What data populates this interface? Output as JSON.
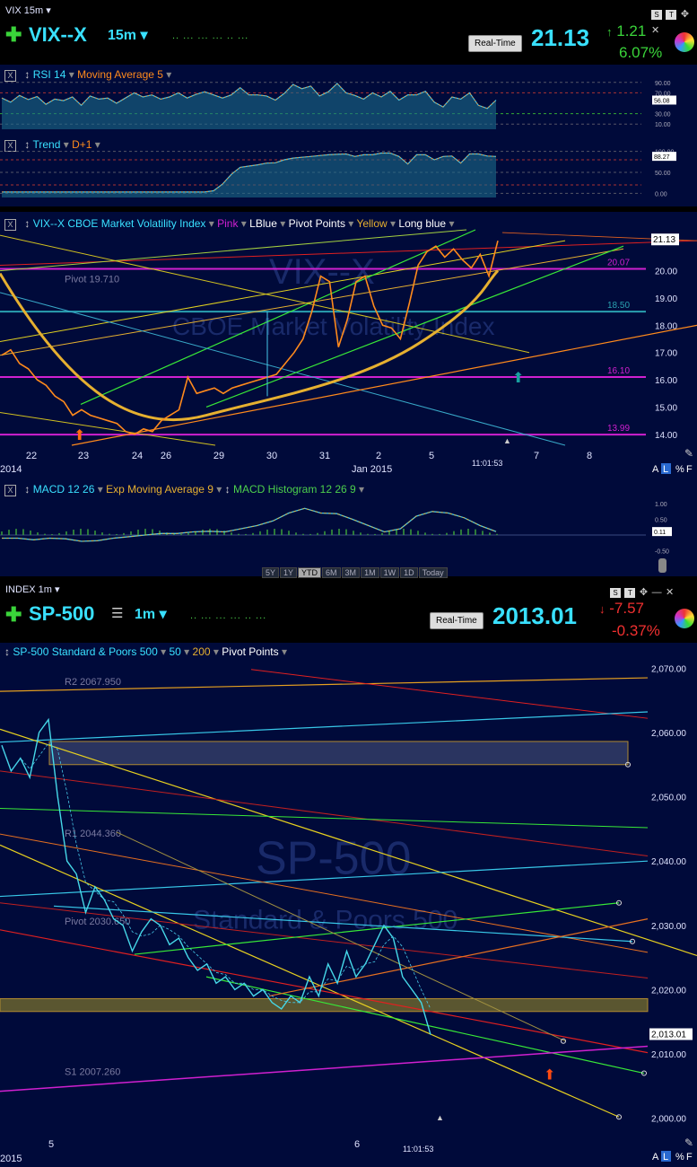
{
  "vix": {
    "window_label": "VIX 15m",
    "symbol": "VIX--X",
    "timeframe": "15m",
    "realtime_label": "Real-Time",
    "price": "21.13",
    "change": "1.21",
    "change_pct": "6.07%",
    "rsi_title": "RSI 14",
    "rsi_ma": "Moving Average 5",
    "trend_title": "Trend",
    "trend_sub": "D+1",
    "main_title": "VIX--X CBOE Market Volatility Index",
    "overlays": [
      "Pink",
      "LBlue",
      "Pivot Points",
      "Yellow",
      "Long blue"
    ],
    "pivot_label": "Pivot 19.710",
    "watermark1": "VIX--X",
    "watermark2": "CBOE Market Volatility Index",
    "macd_title": "MACD 12 26",
    "macd_ema": "Exp Moving Average 9",
    "macd_hist": "MACD Histogram 12 26 9",
    "time_label": "11:01:53",
    "date_left": "2014",
    "date_mid": "Jan 2015",
    "scale_buttons": [
      "A",
      "L",
      "%",
      "F"
    ],
    "range_buttons": [
      "5Y",
      "1Y",
      "YTD",
      "6M",
      "3M",
      "1M",
      "1W",
      "1D",
      "Today"
    ]
  },
  "spx": {
    "window_label": "INDEX 1m",
    "symbol": "SP-500",
    "timeframe": "1m",
    "realtime_label": "Real-Time",
    "price": "2013.01",
    "change": "-7.57",
    "change_pct": "-0.37%",
    "main_title": "SP-500 Standard & Poors 500",
    "overlays": [
      "50",
      "200",
      "Pivot Points"
    ],
    "r2_label": "R2 2067.950",
    "r1_label": "R1 2044.360",
    "pivot_label": "Pivot 2030.650",
    "s1_label": "S1 2007.260",
    "watermark1": "SP-500",
    "watermark2": "Standard & Poors 500",
    "time_label": "11:01:53",
    "date_left": "2015",
    "scale_buttons": [
      "A",
      "L",
      "%",
      "F"
    ]
  },
  "chart_data": [
    {
      "type": "line",
      "title": "VIX--X CBOE Market Volatility Index",
      "x_ticks": [
        "22",
        "23",
        "24",
        "26",
        "29",
        "30",
        "31",
        "2",
        "5",
        "7",
        "8"
      ],
      "y_ticks": [
        "14.00",
        "15.00",
        "16.00",
        "17.00",
        "18.00",
        "19.00",
        "20.00"
      ],
      "ylim": [
        13.6,
        21.5
      ],
      "last_price": "21.13",
      "price_labels": [
        "20.07",
        "18.50",
        "16.10",
        "13.99"
      ],
      "colors": {
        "price": "#ff8a1c",
        "ma": "#e6b030",
        "pink": "#d020d0",
        "lblue": "#38c8e8",
        "green": "#38e838",
        "red": "#e02020",
        "yellow": "#e0d020"
      },
      "series": [
        {
          "values": [
            16.9,
            17.1,
            16.6,
            16.4,
            16.0,
            15.8,
            15.4,
            15.2,
            14.7,
            14.9,
            14.7,
            14.6,
            14.5,
            14.4,
            14.1,
            14.0,
            14.2,
            14.1,
            14.5,
            14.7,
            14.9,
            16.1,
            15.5,
            15.6,
            15.7,
            15.5,
            15.7,
            15.8,
            15.9,
            16.0,
            16.1,
            16.2,
            16.6,
            17.0,
            17.5,
            18.5,
            19.8,
            19.6,
            17.2,
            18.2,
            19.6,
            19.8,
            18.7,
            18.0,
            17.9,
            17.5,
            18.8,
            20.2,
            20.7,
            20.9,
            20.5,
            20.8,
            20.4,
            20.1,
            20.6,
            19.8,
            21.1
          ]
        }
      ]
    },
    {
      "type": "line",
      "title": "RSI 14",
      "y_ticks": [
        "90.00",
        "70.00",
        "30.00",
        "10.00"
      ],
      "ylim": [
        0,
        100
      ],
      "last_value": "56.08",
      "series": [
        {
          "values": [
            60,
            52,
            65,
            57,
            63,
            48,
            58,
            55,
            62,
            46,
            64,
            58,
            60,
            50,
            60,
            70,
            62,
            66,
            58,
            62,
            70,
            60,
            67,
            72,
            66,
            60,
            66,
            80,
            66,
            66,
            64,
            56,
            69,
            86,
            78,
            83,
            64,
            72,
            88,
            70,
            65,
            58,
            70,
            62,
            73,
            56,
            66,
            66,
            73,
            52,
            43,
            62,
            58,
            70,
            46,
            40,
            56
          ]
        }
      ]
    },
    {
      "type": "line",
      "title": "Trend",
      "y_ticks": [
        "100.00",
        "50.00",
        "0.00"
      ],
      "ylim": [
        -10,
        110
      ],
      "last_value": "88.27",
      "series": [
        {
          "values": [
            3,
            3,
            3,
            3,
            3,
            3,
            3,
            3,
            3,
            3,
            3,
            3,
            3,
            3,
            3,
            3,
            3,
            3,
            3,
            3,
            3,
            3,
            3,
            3,
            6,
            22,
            45,
            62,
            65,
            68,
            72,
            73,
            80,
            84,
            86,
            88,
            90,
            92,
            93,
            94,
            88,
            92,
            92,
            96,
            96,
            88,
            70,
            92,
            92,
            80,
            88,
            89,
            72,
            94,
            94,
            89,
            88
          ]
        }
      ]
    },
    {
      "type": "line",
      "title": "MACD 12 26",
      "y_ticks": [
        "1.00",
        "0.50",
        "-0.50"
      ],
      "ylim": [
        -0.8,
        1.2
      ],
      "last_value": "0.11",
      "series": [
        {
          "values": [
            -0.1,
            -0.1,
            -0.15,
            -0.1,
            -0.12,
            -0.2,
            -0.18,
            -0.1,
            -0.05,
            0.0,
            0.05,
            0.05,
            0.1,
            0.12,
            0.1,
            0.2,
            0.3,
            0.45,
            0.7,
            0.85,
            0.7,
            0.68,
            0.5,
            0.3,
            0.1,
            0.2,
            0.6,
            0.75,
            0.7,
            0.55,
            0.3,
            0.11
          ]
        }
      ]
    },
    {
      "type": "line",
      "title": "SP-500 Standard & Poors 500",
      "x_ticks": [
        "5",
        "6"
      ],
      "y_ticks": [
        "2,070.00",
        "2,060.00",
        "2,050.00",
        "2,040.00",
        "2,030.00",
        "2,020.00",
        "2,010.00",
        "2,000.00"
      ],
      "ylim": [
        1998,
        2072
      ],
      "last_price": "2,013.01",
      "pivots": {
        "R2": 2067.95,
        "R1": 2044.36,
        "Pivot": 2030.65,
        "S1": 2007.26
      },
      "series": [
        {
          "values": [
            2058,
            2054,
            2056,
            2053,
            2060,
            2062,
            2050,
            2040,
            2038,
            2032,
            2036,
            2034,
            2031,
            2030,
            2026,
            2029,
            2031,
            2030,
            2027,
            2028,
            2025,
            2023,
            2024,
            2021,
            2022,
            2020,
            2021,
            2019,
            2020,
            2018,
            2017,
            2019,
            2018,
            2022,
            2019,
            2024,
            2021,
            2026,
            2022,
            2024,
            2027,
            2030,
            2028,
            2022,
            2020,
            2018,
            2013
          ]
        }
      ]
    }
  ]
}
